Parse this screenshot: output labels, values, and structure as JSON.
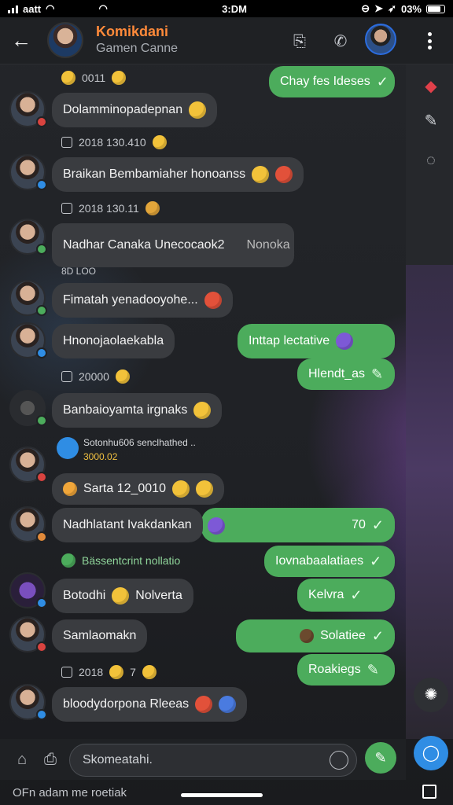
{
  "status": {
    "carrier": "aatt",
    "time": "3:DM",
    "battery": "03%"
  },
  "header": {
    "title": "Komikdani",
    "subtitle": "Gamen Canne"
  },
  "messages": [
    {
      "meta": "0011",
      "out": "Chay fes Ideses"
    },
    {
      "in": "Dolamminopadepnan"
    },
    {
      "meta": "2018 130.410"
    },
    {
      "in": "Braikan Bembamiaher honoanss"
    },
    {
      "meta": "2018 130.11"
    },
    {
      "in": "Nadhar Canaka Unecocaok2",
      "extra": "Nonoka",
      "meta": "8D LOO"
    },
    {
      "in": "Fimatah yenadooyohe..."
    },
    {
      "in": "Hnonojaolaekabla",
      "out": "Inttap lectative"
    },
    {
      "meta": "20000",
      "out": "Hlendt_as"
    },
    {
      "in": "Banbaioyamta irgnaks"
    },
    {
      "system": "Sotonhu606 senclhathed ..",
      "system2": "3000.02"
    },
    {
      "in": "Sarta 12_0010"
    },
    {
      "in": "Nadhlatant Ivakdankan",
      "out": "70"
    },
    {
      "meta": "Bässentcrint nollatio",
      "out": "Iovnabaalatiaes"
    },
    {
      "in": "Botodhi",
      "extra": "Nolverta",
      "out": "Kelvra"
    },
    {
      "in": "Samlaomakn",
      "out": "Solatiee"
    },
    {
      "meta": "2018",
      "meta2": "7",
      "out": "Roakiegs"
    },
    {
      "in": "bloodydorpona Rleeas"
    }
  ],
  "composer": {
    "placeholder": "Skomeatahi.",
    "footer": "OFn adam me roetiak"
  }
}
